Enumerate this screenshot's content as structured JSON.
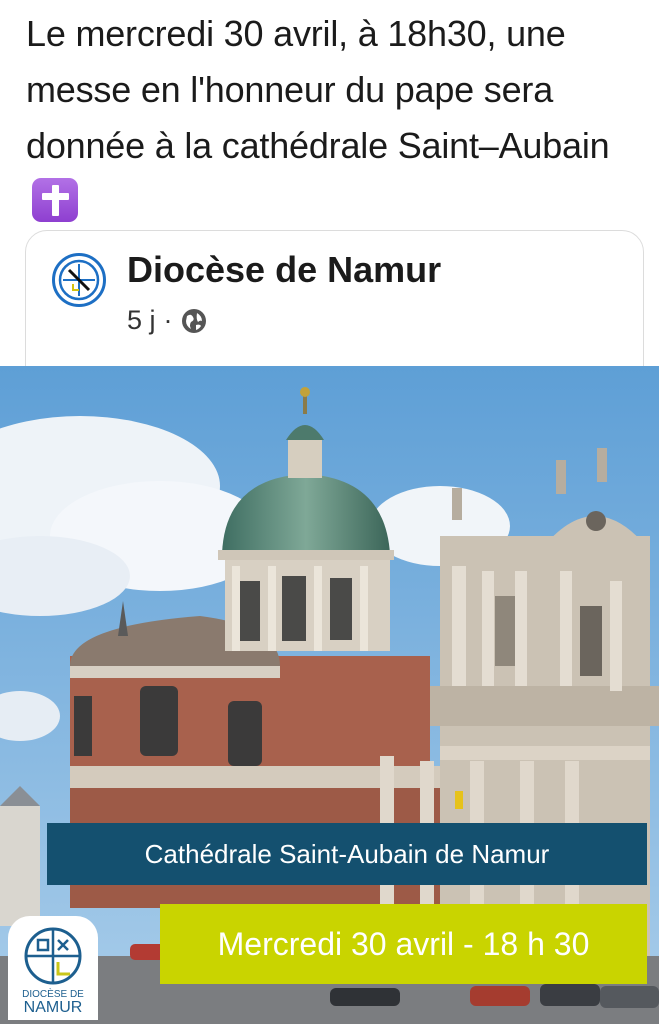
{
  "post": {
    "text": "Le mercredi 30 avril, à 18h30, une messe en l'honneur du pape sera donnée à la cathédrale Saint–Aubain",
    "emoji": "latin-cross-emoji"
  },
  "shared": {
    "page_name": "Diocèse de Namur",
    "age": "5 j",
    "separator": "·",
    "audience_icon": "globe-icon"
  },
  "image": {
    "banner_location": "Cathédrale Saint-Aubain de Namur",
    "banner_date": "Mercredi 30 avril - 18 h 30",
    "logo_line1": "DIOCÈSE DE",
    "logo_line2": "NAMUR",
    "colors": {
      "banner_blue": "#14506f",
      "banner_green": "#c9d400",
      "logo_blue": "#1d5f8f"
    }
  }
}
